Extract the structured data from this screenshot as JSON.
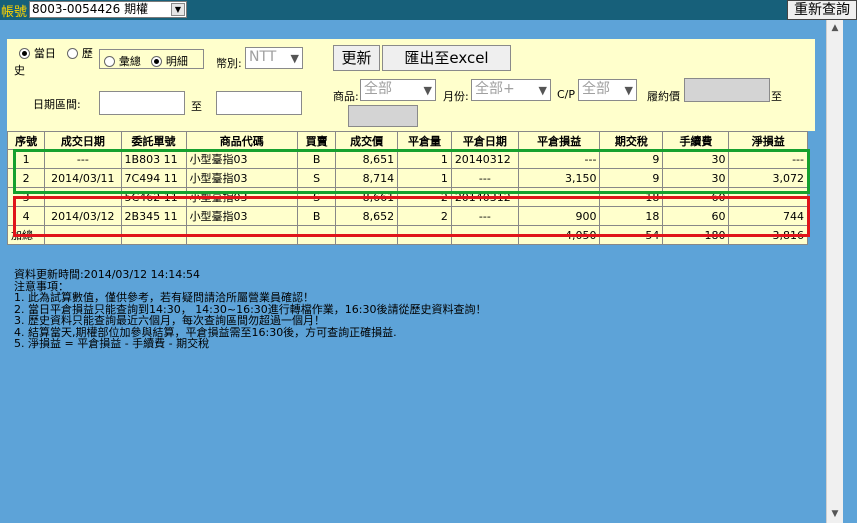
{
  "topbar": {
    "account_label": "帳號",
    "account_value": "8003-0054426  期權",
    "refresh_label": "重新查詢"
  },
  "filters": {
    "day_radio": "當日",
    "history_radio_part1": "歷",
    "history_radio_part2": "史",
    "summary_radio": "彙總",
    "detail_radio": "明細",
    "currency_label": "幣別:",
    "currency_value": "NTT",
    "update_button": "更新",
    "export_button": "匯出至excel",
    "date_range_label": "日期區間:",
    "to_label": "至",
    "product_label": "商品:",
    "product_value": "全部",
    "month_label": "月份:",
    "month_value": "全部+",
    "cp_label": "C/P",
    "cp_value": "全部",
    "strike_label": "履約價",
    "strike_to_label": "至"
  },
  "table": {
    "headers": [
      "序號",
      "成交日期",
      "委託單號",
      "商品代碼",
      "買賣",
      "成交價",
      "平倉量",
      "平倉日期",
      "平倉損益",
      "期交稅",
      "手續費",
      "淨損益"
    ],
    "rows": [
      [
        "1",
        "---",
        "1B803 11",
        "小型臺指03",
        "B",
        "8,651",
        "1",
        "20140312",
        "---",
        "9",
        "30",
        "---"
      ],
      [
        "2",
        "2014/03/11",
        "7C494 11",
        "小型臺指03",
        "S",
        "8,714",
        "1",
        "---",
        "3,150",
        "9",
        "30",
        "3,072"
      ],
      [
        "3",
        "---",
        "5C462 11",
        "小型臺指03",
        "S",
        "8,661",
        "2",
        "20140312",
        "---",
        "18",
        "60",
        "---"
      ],
      [
        "4",
        "2014/03/12",
        "2B345 11",
        "小型臺指03",
        "B",
        "8,652",
        "2",
        "---",
        "900",
        "18",
        "60",
        "744"
      ]
    ],
    "total": [
      "加總",
      "",
      "",
      "",
      "",
      "",
      "",
      "",
      "4,050",
      "54",
      "180",
      "3,816"
    ]
  },
  "notes": {
    "updated": "資料更新時間:2014/03/12 14:14:54",
    "title": " 注意事項：",
    "line1": "1. 此為試算數值，僅供參考，若有疑問請洽所屬營業員確認！",
    "line2": "2. 當日平倉損益只能查詢到14:30， 14:30~16:30進行轉檔作業，16:30後請從歷史資料查詢！",
    "line3": "3. 歷史資料只能查詢最近六個月，每次查詢區間勿超過一個月！",
    "line4": "4. 結算當天,期權部位加參與結算，平倉損益需至16:30後，方可查詢正確損益.",
    "line5": "5. 淨損益 = 平倉損益 - 手續費 - 期交稅"
  },
  "colors": {
    "background": "#5da3d8",
    "panel": "#ffffcc",
    "topbar": "#17607a",
    "account_label": "#ffd400",
    "highlight_green": "#16a02e",
    "highlight_red": "#e0141a"
  }
}
